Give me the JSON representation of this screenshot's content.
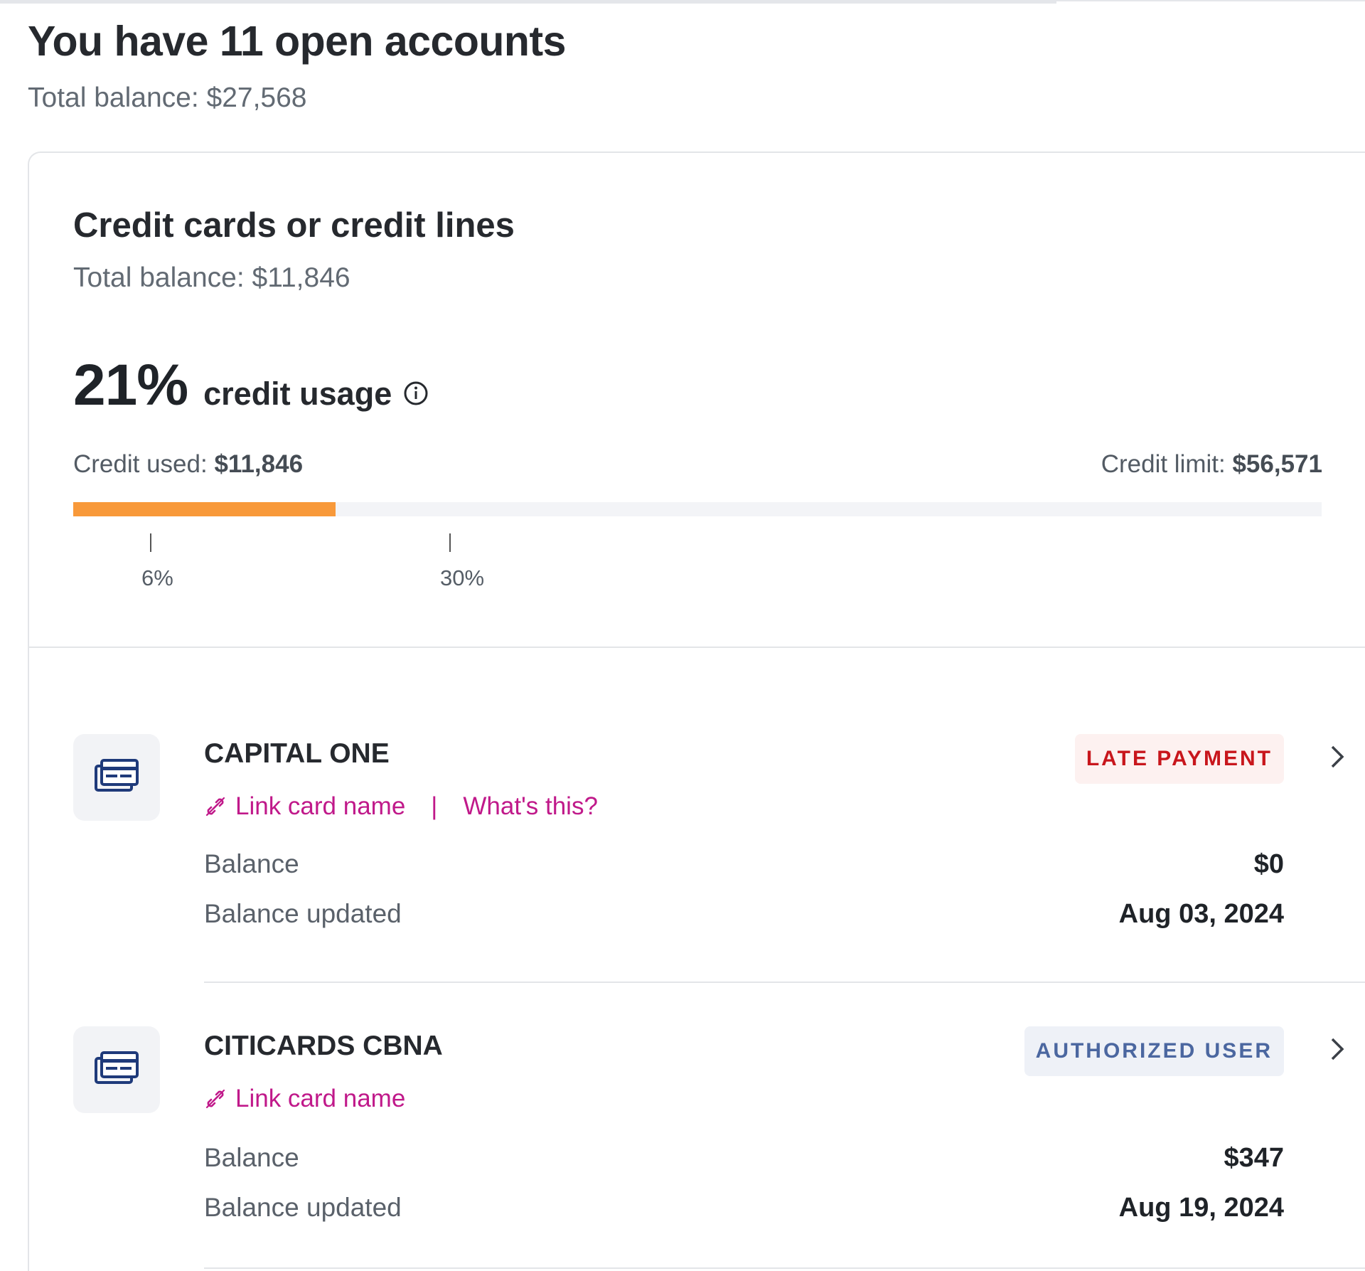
{
  "header": {
    "title": "You have 11 open accounts",
    "total_balance": "Total balance: $27,568"
  },
  "credit": {
    "title": "Credit cards or credit lines",
    "total_balance": "Total balance: $11,846",
    "usage_percent": "21%",
    "usage_label": "credit usage",
    "info_icon": "info-icon",
    "used_label": "Credit used:",
    "used_value": "$11,846",
    "limit_label": "Credit limit:",
    "limit_value": "$56,571",
    "bar_fill_fraction": 0.21,
    "bar_color": "#f8993a",
    "markers": [
      {
        "label": "6%"
      },
      {
        "label": "30%"
      }
    ]
  },
  "accounts": [
    {
      "name": "CAPITAL ONE",
      "badge": "LATE PAYMENT",
      "badge_color": "#c8161c",
      "icon": "credit-card-icon",
      "link_label": "Link card name",
      "link_sep": "|",
      "help_label": "What's this?",
      "balance_label": "Balance",
      "balance_value": "$0",
      "updated_label": "Balance updated",
      "updated_value": "Aug 03, 2024"
    },
    {
      "name": "CITICARDS CBNA",
      "badge": "AUTHORIZED USER",
      "badge_color": "#4b67a0",
      "icon": "credit-card-icon",
      "link_label": "Link card name",
      "balance_label": "Balance",
      "balance_value": "$347",
      "updated_label": "Balance updated",
      "updated_value": "Aug 19, 2024"
    }
  ],
  "colors": {
    "accent_link": "#c0198a",
    "icon_blue": "#1f3a7a"
  }
}
